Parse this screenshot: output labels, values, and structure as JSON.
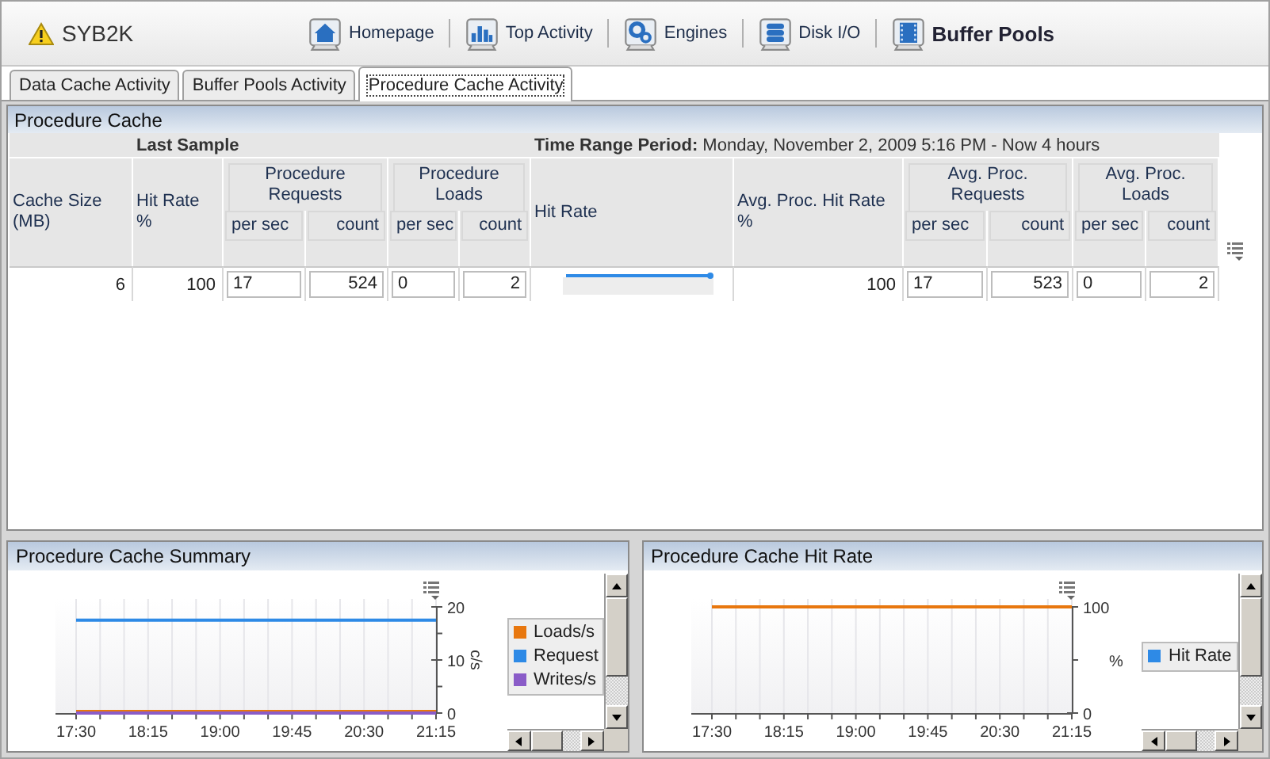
{
  "server": {
    "name": "SYB2K",
    "warning": true
  },
  "nav": [
    {
      "label": "Homepage",
      "selected": false
    },
    {
      "label": "Top Activity",
      "selected": false
    },
    {
      "label": "Engines",
      "selected": false
    },
    {
      "label": "Disk I/O",
      "selected": false
    },
    {
      "label": "Buffer Pools",
      "selected": true
    }
  ],
  "tabs": [
    {
      "label": "Data Cache Activity",
      "selected": false
    },
    {
      "label": "Buffer Pools Activity",
      "selected": false
    },
    {
      "label": "Procedure Cache Activity",
      "selected": true
    }
  ],
  "procedure_cache": {
    "title": "Procedure Cache",
    "group_headers": [
      "Last Sample",
      "**Time Range Period:** Monday, November 2, 2009  5:16 PM - Now  4 hours"
    ],
    "columns": [
      {
        "label": "Cache Size\n(MB)"
      },
      {
        "label": "Hit Rate\n%"
      },
      {
        "label": "Procedure\nRequests",
        "sub": [
          "per sec",
          "count"
        ]
      },
      {
        "label": "Procedure\nLoads",
        "sub": [
          "per sec",
          "count"
        ]
      },
      {
        "label": "Hit Rate"
      },
      {
        "label": "Avg. Proc. Hit Rate\n%"
      },
      {
        "label": "Avg. Proc.\nRequests",
        "sub": [
          "per sec",
          "count"
        ]
      },
      {
        "label": "Avg. Proc.\nLoads",
        "sub": [
          "per sec",
          "count"
        ]
      }
    ],
    "rows": [
      {
        "cells": [
          {
            "kind": "text",
            "value": "6"
          },
          {
            "kind": "text",
            "value": "100"
          },
          {
            "kind": "pair",
            "values": [
              "17",
              "524"
            ]
          },
          {
            "kind": "pair",
            "values": [
              "0",
              "2"
            ]
          },
          {
            "kind": "sparkline"
          },
          {
            "kind": "text",
            "value": "100"
          },
          {
            "kind": "pair",
            "values": [
              "17",
              "523"
            ]
          },
          {
            "kind": "pair",
            "values": [
              "0",
              "2"
            ]
          }
        ]
      }
    ]
  },
  "panels": [
    {
      "title": "Procedure Cache Summary",
      "chart_data": {
        "type": "line",
        "categories": [
          "17:30",
          "18:15",
          "19:00",
          "19:45",
          "20:30",
          "21:15"
        ],
        "ylabel": "c/s",
        "ylim": [
          0,
          20
        ],
        "yticks": [
          0,
          10,
          20
        ],
        "grid": true,
        "series": [
          {
            "color": "#e8770e",
            "values": [
              0.3,
              0.3,
              0.3,
              0.3,
              0.3,
              0.3
            ]
          },
          {
            "color": "#2e8ae6",
            "values": [
              17.5,
              17.5,
              17.5,
              17.5,
              17.5,
              17.5
            ]
          },
          {
            "color": "#8a5cc8",
            "values": [
              0,
              0,
              0,
              0,
              0,
              0
            ]
          }
        ]
      },
      "legend": [
        {
          "label": "Loads/s",
          "color": "#e8770e"
        },
        {
          "label": "Request",
          "color": "#2e8ae6"
        },
        {
          "label": "Writes/s",
          "color": "#8a5cc8"
        }
      ]
    },
    {
      "title": "Procedure Cache Hit Rate",
      "chart_data": {
        "type": "line",
        "categories": [
          "17:30",
          "18:15",
          "19:00",
          "19:45",
          "20:30",
          "21:15"
        ],
        "ylabel": "%",
        "ylim": [
          0,
          100
        ],
        "yticks": [
          0,
          100
        ],
        "grid": true,
        "series": [
          {
            "color": "#e8770e",
            "values": [
              100,
              100,
              100,
              100,
              100,
              100
            ]
          }
        ]
      },
      "legend": [
        {
          "label": "Hit Rate",
          "color": "#2e8ae6"
        }
      ]
    }
  ]
}
